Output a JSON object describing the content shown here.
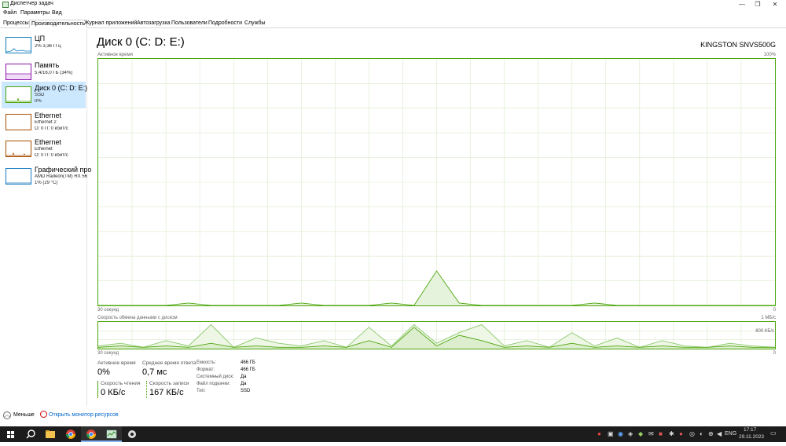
{
  "window": {
    "title": "Диспетчер задач"
  },
  "menu": [
    "Файл",
    "Параметры",
    "Вид"
  ],
  "tabs": [
    "Процессы",
    "Производительность",
    "Журнал приложений",
    "Автозагрузка",
    "Пользователи",
    "Подробности",
    "Службы"
  ],
  "active_tab": "Производительность",
  "sidebar": [
    {
      "name": "ЦП",
      "lines": [
        "2% 3,36 ГГц"
      ],
      "color": "#117dbb"
    },
    {
      "name": "Память",
      "lines": [
        "5,4/16,0 ГБ (34%)"
      ],
      "color": "#8b12ae"
    },
    {
      "name": "Диск 0 (C: D: E:)",
      "lines": [
        "SSD",
        "0%"
      ],
      "color": "#4da60c",
      "selected": true
    },
    {
      "name": "Ethernet",
      "lines": [
        "Ethernet 2",
        "О: 0 П: 0 кбит/с"
      ],
      "color": "#a74f01"
    },
    {
      "name": "Ethernet",
      "lines": [
        "Ethernet",
        "О: 0 П: 0 кбит/с"
      ],
      "color": "#a74f01"
    },
    {
      "name": "Графический про",
      "lines": [
        "AMD Radeon(TM) RX 56",
        "1% (29 °C)"
      ],
      "color": "#1a7bbf"
    }
  ],
  "main": {
    "title": "Диск 0 (C: D: E:)",
    "model": "KINGSTON SNVS500G",
    "graph1": {
      "label": "Активное время",
      "max": "100%",
      "time": "30 секунд",
      "min": "0"
    },
    "graph2": {
      "label": "Скорость обмена данными с диском",
      "max": "1 МБ/с",
      "mid": "800 КБ/с",
      "time": "30 секунд",
      "min": "0"
    }
  },
  "stats": {
    "active_time_label": "Активное время",
    "active_time": "0%",
    "avg_response_label": "Среднее время ответа",
    "avg_response": "0,7 мс",
    "read_label": "Скорость чтения",
    "read": "0 КБ/с",
    "write_label": "Скорость записи",
    "write": "167 КБ/с"
  },
  "properties": [
    {
      "k": "Емкость:",
      "v": "466 ГБ"
    },
    {
      "k": "Формат:",
      "v": "466 ГБ"
    },
    {
      "k": "Системный диск:",
      "v": "Да"
    },
    {
      "k": "Файл подкачки:",
      "v": "Да"
    },
    {
      "k": "Тип:",
      "v": "SSD"
    }
  ],
  "footer": {
    "less": "Меньше",
    "monitor": "Открыть монитор ресурсов"
  },
  "taskbar": {
    "lang": "ENG",
    "time": "17:17",
    "date": "29.11.2023"
  },
  "chart_data": [
    {
      "type": "area",
      "title": "Активное время",
      "ylim": [
        0,
        100
      ],
      "x": [
        -30,
        -29,
        -28,
        -27,
        -26,
        -25,
        -24,
        -23,
        -22,
        -21,
        -20,
        -19,
        -18,
        -17,
        -16,
        -15,
        -14,
        -13,
        -12,
        -11,
        -10,
        -9,
        -8,
        -7,
        -6,
        -5,
        -4,
        -3,
        -2,
        -1,
        0
      ],
      "series": [
        {
          "values": [
            0,
            0,
            0,
            0,
            1,
            0,
            0,
            0,
            0,
            1,
            0,
            0,
            0,
            1,
            0,
            14,
            1,
            0,
            0,
            0,
            0,
            0,
            1,
            0,
            0,
            0,
            0,
            0,
            0,
            0,
            0
          ]
        }
      ]
    },
    {
      "type": "line",
      "title": "Скорость обмена данными с диском",
      "ylim": [
        0,
        1
      ],
      "series": [
        {
          "values": [
            0.1,
            0.2,
            0.05,
            0.3,
            0.1,
            0.9,
            0.05,
            0.4,
            0.2,
            0.1,
            0.3,
            0.05,
            0.8,
            0.1,
            0.9,
            0.2,
            0.6,
            0.9,
            0.1,
            0.3,
            0.05,
            0.6,
            0.1,
            0.4,
            0.05,
            0.3,
            0.1,
            0.05,
            0.2,
            0.1,
            0.05
          ]
        },
        {
          "values": [
            0.05,
            0.1,
            0.05,
            0.1,
            0.05,
            0.2,
            0.05,
            0.1,
            0.05,
            0.05,
            0.1,
            0.05,
            0.3,
            0.05,
            0.8,
            0.1,
            0.5,
            0.3,
            0.05,
            0.1,
            0.05,
            0.2,
            0.05,
            0.1,
            0.05,
            0.1,
            0.05,
            0.05,
            0.1,
            0.05,
            0.05
          ]
        }
      ]
    }
  ]
}
